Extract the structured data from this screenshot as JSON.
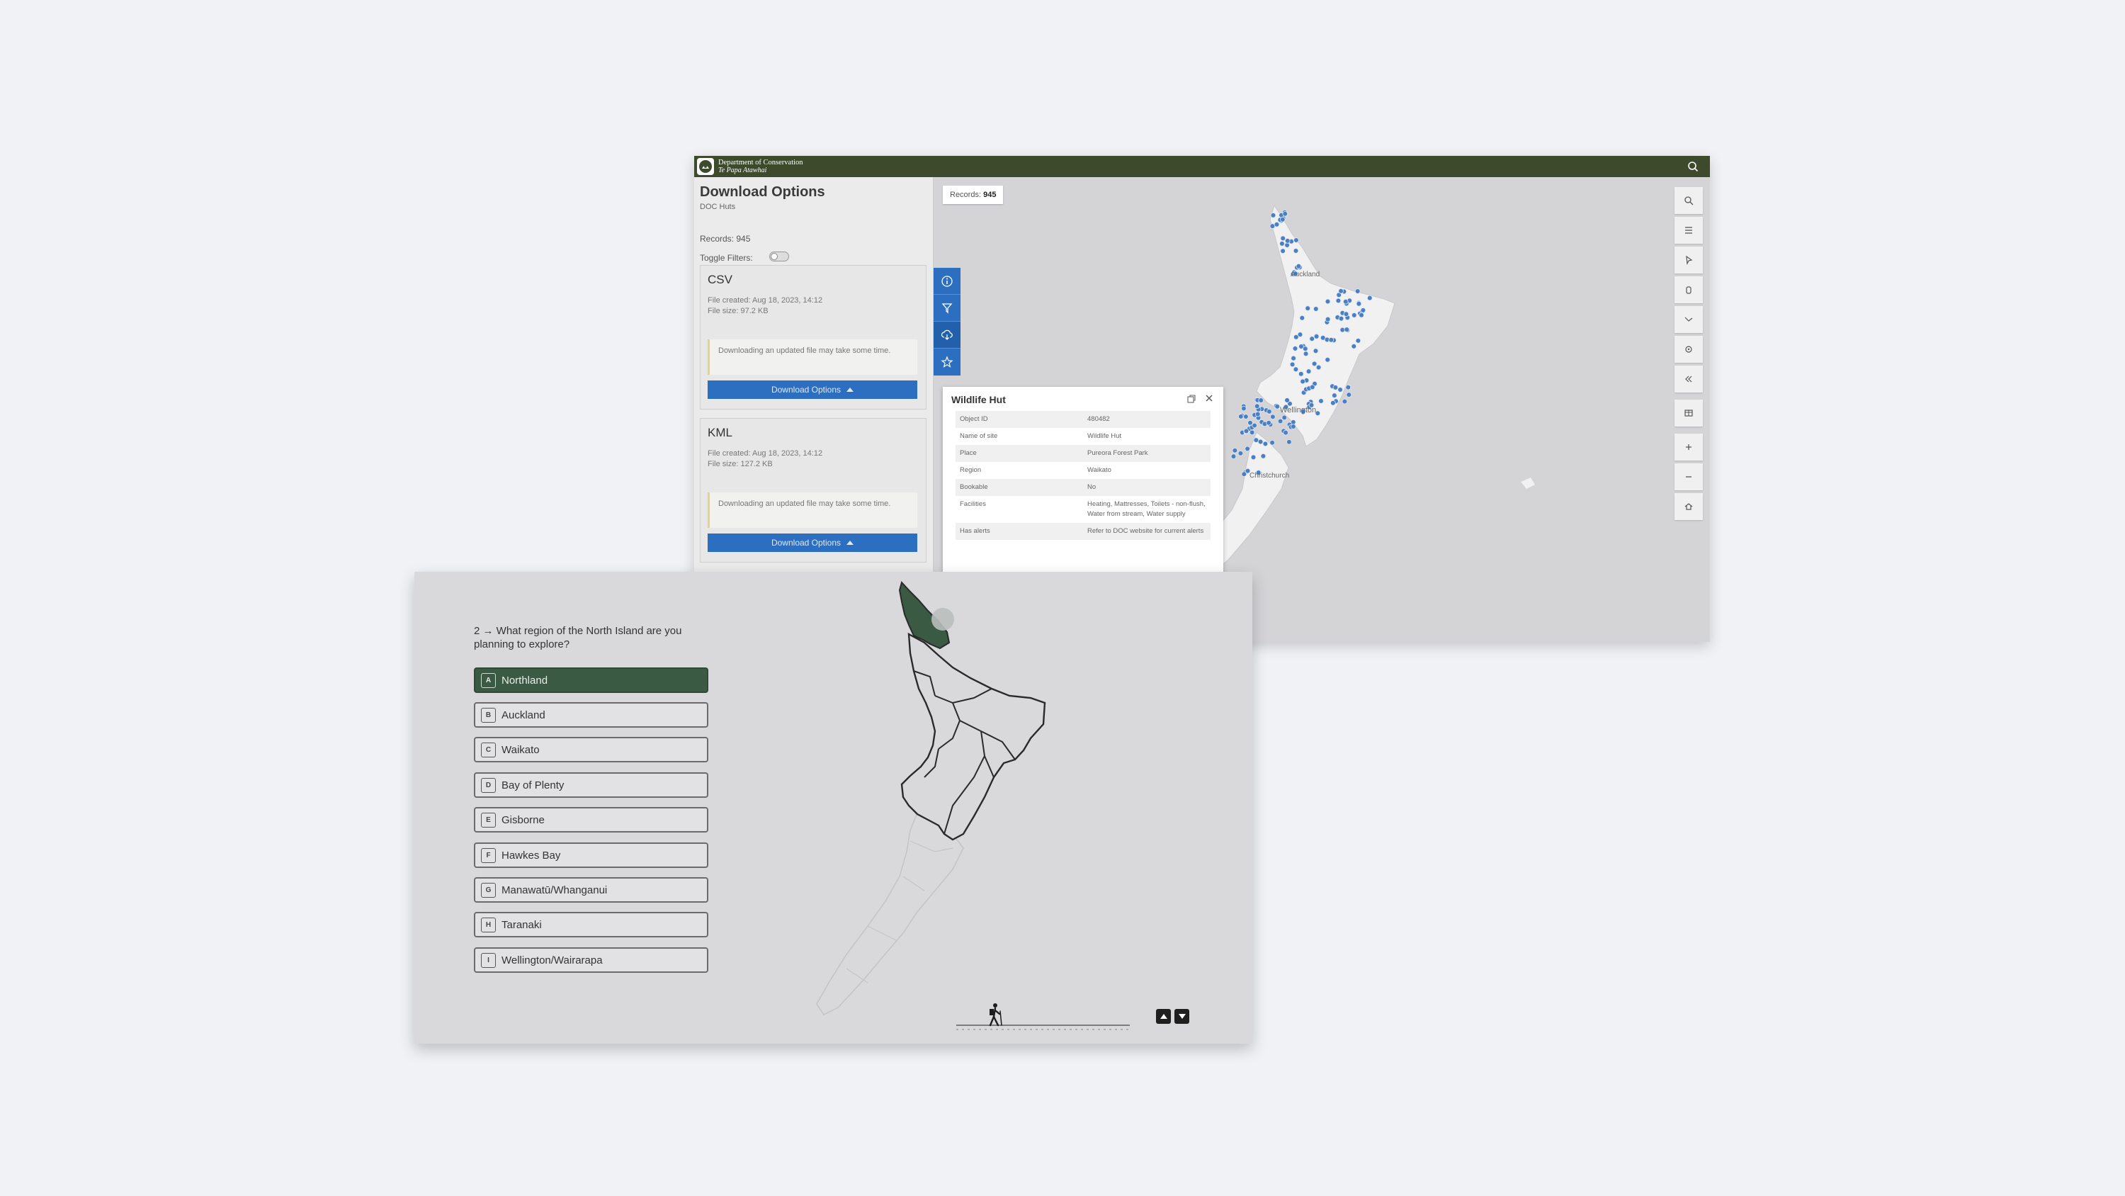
{
  "header": {
    "org_line1": "Department of Conservation",
    "org_line2": "Te Papa Atawhai"
  },
  "panel": {
    "title": "Download Options",
    "subtitle": "DOC Huts",
    "records": "Records: 945",
    "toggle_label": "Toggle Filters:",
    "cards": [
      {
        "format": "CSV",
        "created": "File created: Aug 18, 2023, 14:12",
        "size": "File size: 97.2 KB",
        "notice": "Downloading an updated file may take some time.",
        "button": "Download Options"
      },
      {
        "format": "KML",
        "created": "File created: Aug 18, 2023, 14:12",
        "size": "File size: 127.2 KB",
        "notice": "Downloading an updated file may take some time.",
        "button": "Download Options"
      }
    ]
  },
  "map": {
    "records_label": "Records:",
    "records_value": "945",
    "place_labels": {
      "auckland": "Auckland",
      "wellington": "Wellington",
      "christchurch": "Christchurch"
    }
  },
  "popup": {
    "title": "Wildlife Hut",
    "rows": [
      {
        "key": "Object ID",
        "value": "480482"
      },
      {
        "key": "Name of site",
        "value": "Wildlife Hut"
      },
      {
        "key": "Place",
        "value": "Pureora Forest Park"
      },
      {
        "key": "Region",
        "value": "Waikato"
      },
      {
        "key": "Bookable",
        "value": "No"
      },
      {
        "key": "Facilities",
        "value": "Heating, Mattresses, Toilets - non-flush, Water from stream, Water supply"
      },
      {
        "key": "Has alerts",
        "value": "Refer to DOC website for current alerts"
      }
    ]
  },
  "quiz": {
    "question": "2 → What region of the North Island are you planning to explore?",
    "selected_index": 0,
    "options": [
      {
        "key": "A",
        "label": "Northland"
      },
      {
        "key": "B",
        "label": "Auckland"
      },
      {
        "key": "C",
        "label": "Waikato"
      },
      {
        "key": "D",
        "label": "Bay of Plenty"
      },
      {
        "key": "E",
        "label": "Gisborne"
      },
      {
        "key": "F",
        "label": "Hawkes Bay"
      },
      {
        "key": "G",
        "label": "Manawatū/Whanganui"
      },
      {
        "key": "H",
        "label": "Taranaki"
      },
      {
        "key": "I",
        "label": "Wellington/Wairarapa"
      }
    ]
  },
  "colors": {
    "header": "#3e4a2c",
    "accent_blue": "#2c6fc0",
    "selected_green": "#3a5a43",
    "hut_marker": "#4a7fc4"
  }
}
